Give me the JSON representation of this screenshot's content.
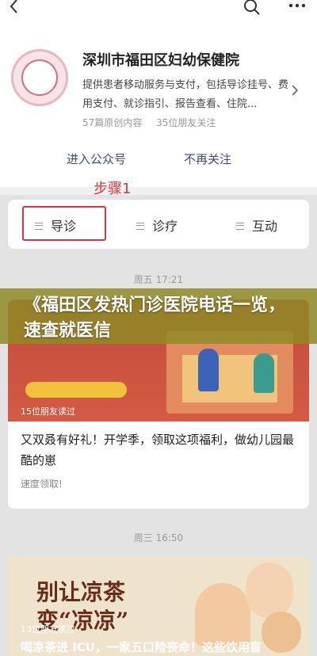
{
  "topbar": {
    "back_icon": "chevron-left-icon",
    "search_icon": "search-icon",
    "more_icon": "more-dots-icon"
  },
  "profile": {
    "name": "深圳市福田区妇幼保健院",
    "description": "提供患者移动服务与支付，包括导诊挂号、费用支付、就诊指引、报告查看、住院...",
    "articles": "57篇原创内容",
    "friends": "35位朋友关注",
    "follow_label": "进入公众号",
    "unfollow_label": "不再关注"
  },
  "annotation": {
    "step_label": "步骤1",
    "highlight_color": "#d9363e"
  },
  "menu": {
    "items": [
      {
        "label": "导诊"
      },
      {
        "label": "诊疗"
      },
      {
        "label": "互动"
      }
    ]
  },
  "feed": {
    "time1": "周五 17:21",
    "time2": "周三 16:50",
    "article1": {
      "reads": "15位朋友读过",
      "title": "又双叒有好礼！开学季，领取这项福利，做幼儿园最酷的崽",
      "subtitle": "速度领取!"
    },
    "article2": {
      "image_text_line1": "别让凉茶",
      "image_text_line2": "变“凉凉”",
      "reads": "13位朋友读过",
      "title": "喝凉茶进 ICU，一家五口险丧命！这些饮用盲"
    }
  },
  "banner": {
    "text": "《福田区发热门诊医院电话一览，速查就医信",
    "color": "#8f8a26"
  }
}
